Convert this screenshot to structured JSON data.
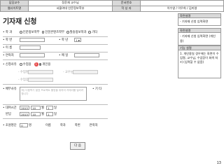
{
  "header": {
    "cell1_k": "담당교수",
    "cell1_v": "정윤재 교수님",
    "cell2_k": "문서번호",
    "cell2_v": "",
    "cell3_k": "웹사이트명",
    "cell3_v": "서울여대 인문정보학부",
    "cell4_k": "작 성 자",
    "cell4_v": "이수영 / 이우희 / 김미영"
  },
  "page_title": "기자재 신청",
  "form": {
    "dept_label": "• 학  과",
    "dept_opt1": "인문정보학부",
    "dept_opt2": "인문콘텐츠학부",
    "dept_opt3": "발송정보학과",
    "dept_opt4": "기타",
    "sid_label": "• 학  번",
    "grade_label": "• 학  년",
    "grade_value": "1",
    "name_label": "• 이  름",
    "phone_label": "• 연락처",
    "email_label": "• 메  일",
    "applicant_label": "• 신청사유",
    "applicant_opt1": "수업용",
    "applicant_opt2": "개인용",
    "badge": "1",
    "course_label": "- 수업명",
    "prof_label": "- 교수님",
    "class_label": "- 수업장",
    "reason_label": "• 배부사유",
    "reason_placeholder": "예) 다음학기 발표 프로젝트 촬영을 위하여 카메라를 빌리려 합니다",
    "other_label": "• 기  타",
    "rent_label": "• 대여시간",
    "rent_year": "2013",
    "rent_month": "10",
    "rent_month_unit": "월",
    "rent_day": "1",
    "rent_day_unit": "일",
    "return_label": "반납",
    "ret_year": "2013",
    "ret_month": "10",
    "ret_month_unit": "월",
    "ret_day": "1",
    "ret_day_unit": "일",
    "co_label": "• 조원명단",
    "co_count": "0",
    "co_unit": "명",
    "co_h1": "이름",
    "co_h2": "학과",
    "co_h3": "학번",
    "co_h4": "연락처"
  },
  "submit_label": "다 음",
  "side": {
    "h1": "화면설명",
    "b1": "- 기자재 신청 입력화면",
    "h2": "화면설명",
    "b2": "- 기자재 신청 입력화면 (개인용)",
    "h3": "기능 설명",
    "b3": "1. 개인용일 경우에는 화면이 수업명, 교수님, 수업장이 회색 처리 (입력할 수 없음)"
  },
  "page_number": "13"
}
